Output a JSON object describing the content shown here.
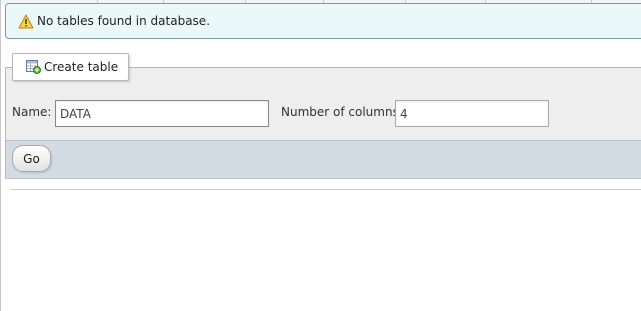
{
  "notice": {
    "icon": "warning-icon",
    "message": "No tables found in database."
  },
  "create_table": {
    "legend_icon": "table-add-icon",
    "legend_label": "Create table",
    "name_label": "Name:",
    "name_value": "DATA",
    "columns_label": "Number of columns:",
    "columns_value": "4",
    "go_label": "Go"
  },
  "colors": {
    "notice_bg": "#ebf8fa",
    "notice_border": "#7a9ba5",
    "fieldset_bg": "#eeeeee",
    "footer_bg": "#d3dce3"
  }
}
